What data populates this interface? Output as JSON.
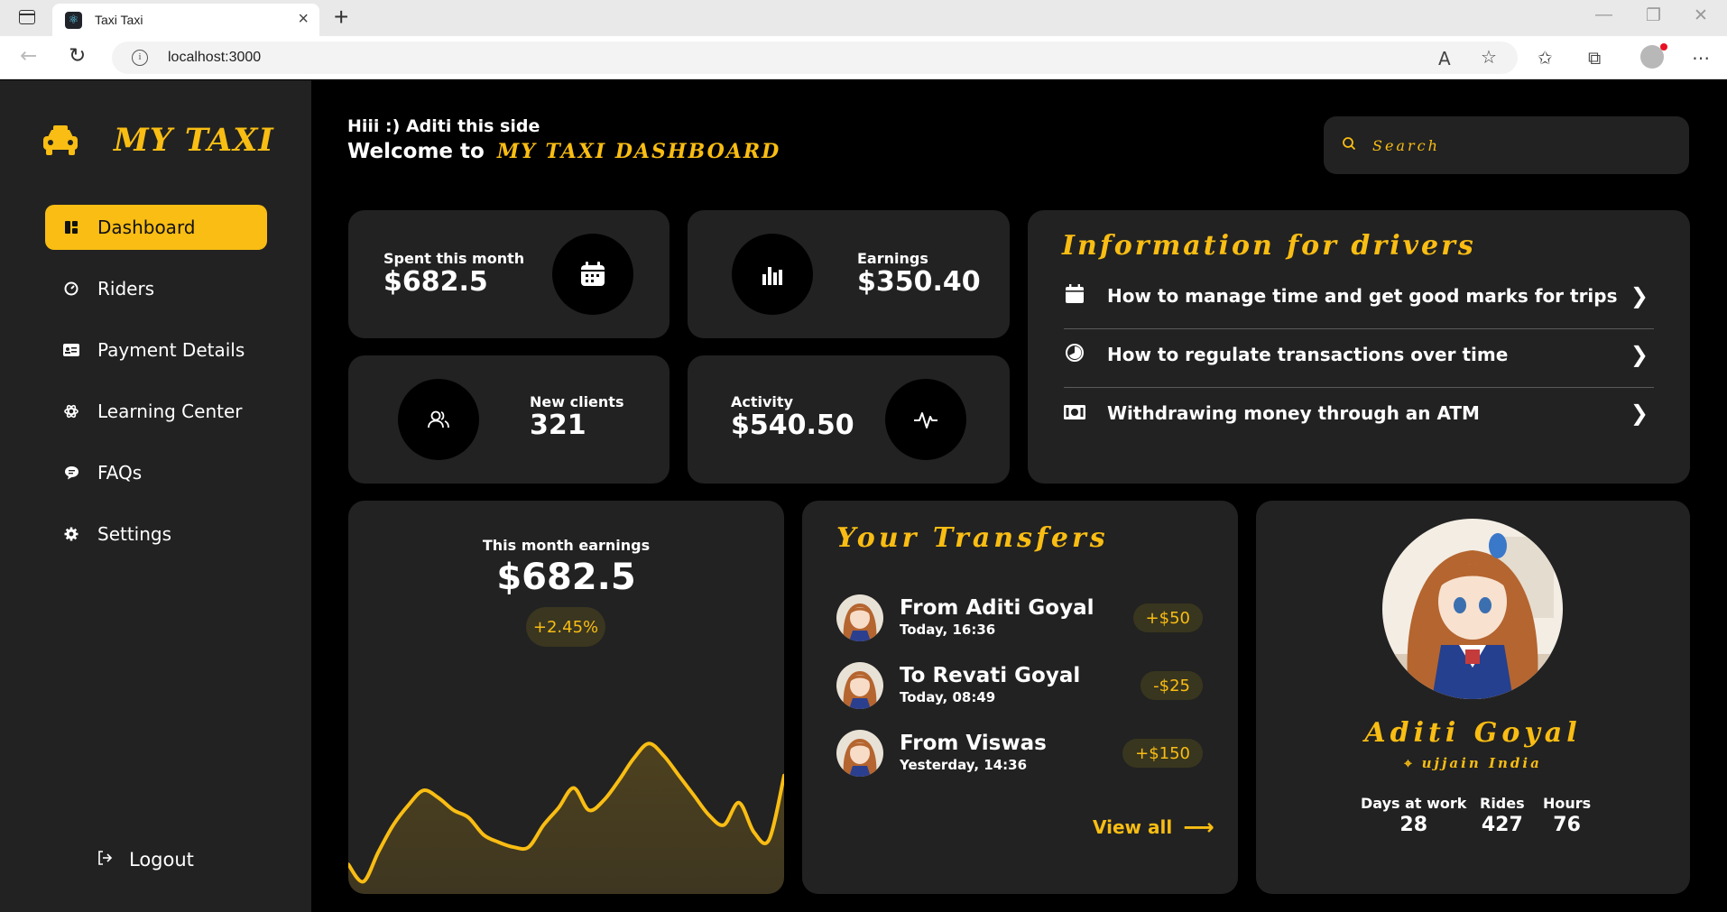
{
  "browser": {
    "tab_title": "Taxi Taxi",
    "tab_close": "×",
    "new_tab": "+",
    "url": "localhost:3000"
  },
  "sidebar": {
    "brand": "MY TAXI",
    "items": [
      {
        "label": "Dashboard",
        "icon": "dashboard-icon",
        "active": true
      },
      {
        "label": "Riders",
        "icon": "gauge-icon",
        "active": false
      },
      {
        "label": "Payment Details",
        "icon": "id-card-icon",
        "active": false
      },
      {
        "label": "Learning Center",
        "icon": "atom-icon",
        "active": false
      },
      {
        "label": "FAQs",
        "icon": "chat-bubble-icon",
        "active": false
      },
      {
        "label": "Settings",
        "icon": "gear-icon",
        "active": false
      }
    ],
    "logout": "Logout"
  },
  "header": {
    "greeting": "Hiii :) Aditi this side",
    "welcome": "Welcome to",
    "welcome_highlight": "MY TAXI DASHBOARD",
    "search_placeholder": "Search"
  },
  "stats": {
    "spent": {
      "label": "Spent this month",
      "value": "$682.5",
      "icon": "calendar-icon"
    },
    "earnings": {
      "label": "Earnings",
      "value": "$350.40",
      "icon": "bar-chart-icon"
    },
    "clients": {
      "label": "New clients",
      "value": "321",
      "icon": "users-icon"
    },
    "activity": {
      "label": "Activity",
      "value": "$540.50",
      "icon": "pulse-icon"
    }
  },
  "info": {
    "title": "Information for drivers",
    "items": [
      {
        "text": "How to manage time and get good marks for trips",
        "icon": "calendar-icon"
      },
      {
        "text": "How to regulate transactions over time",
        "icon": "clock-icon"
      },
      {
        "text": "Withdrawing money through an ATM",
        "icon": "money-icon"
      }
    ]
  },
  "earnings_card": {
    "title": "This month earnings",
    "value": "$682.5",
    "change": "+2.45%"
  },
  "chart_data": {
    "type": "area",
    "title": "",
    "xlabel": "",
    "ylabel": "",
    "grid": false,
    "values": [
      12,
      5,
      17,
      28,
      36,
      42,
      39,
      34,
      31,
      24,
      21,
      19,
      19,
      28,
      35,
      43,
      34,
      38,
      46,
      55,
      61,
      56,
      48,
      40,
      32,
      28,
      37,
      25,
      22,
      48
    ],
    "ylim": [
      0,
      90
    ],
    "color": "#f9bd13"
  },
  "transfers": {
    "title": "Your Transfers",
    "items": [
      {
        "name": "From Aditi Goyal",
        "time": "Today, 16:36",
        "amount": "+$50"
      },
      {
        "name": "To Revati Goyal",
        "time": "Today, 08:49",
        "amount": "-$25"
      },
      {
        "name": "From Viswas",
        "time": "Yesterday, 14:36",
        "amount": "+$150"
      }
    ],
    "view_all": "View all"
  },
  "profile": {
    "name": "Aditi Goyal",
    "location": "ujjain India",
    "stats": [
      {
        "label": "Days at work",
        "value": "28"
      },
      {
        "label": "Rides",
        "value": "427"
      },
      {
        "label": "Hours",
        "value": "76"
      }
    ]
  },
  "colors": {
    "accent": "#f9bd13",
    "card": "#222222",
    "bg": "#000000"
  }
}
